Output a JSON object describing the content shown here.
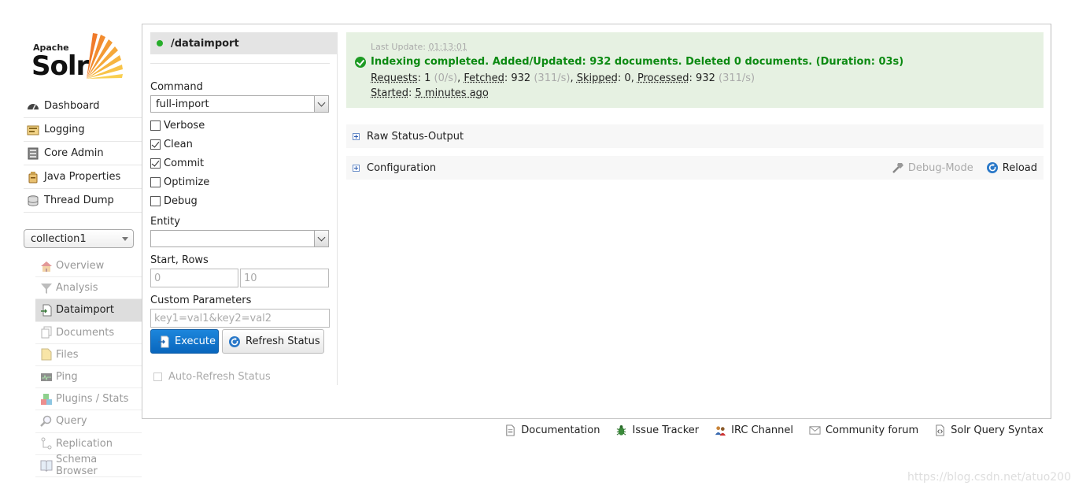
{
  "logo": {
    "apache": "Apache",
    "solr": "Solr"
  },
  "main_nav": [
    {
      "label": "Dashboard",
      "icon": "dashboard-icon"
    },
    {
      "label": "Logging",
      "icon": "logging-icon"
    },
    {
      "label": "Core Admin",
      "icon": "core-admin-icon"
    },
    {
      "label": "Java Properties",
      "icon": "java-properties-icon"
    },
    {
      "label": "Thread Dump",
      "icon": "thread-dump-icon"
    }
  ],
  "core_selector": {
    "value": "collection1"
  },
  "core_nav": [
    {
      "label": "Overview",
      "icon": "overview-icon"
    },
    {
      "label": "Analysis",
      "icon": "analysis-icon"
    },
    {
      "label": "Dataimport",
      "icon": "dataimport-icon",
      "active": true
    },
    {
      "label": "Documents",
      "icon": "documents-icon"
    },
    {
      "label": "Files",
      "icon": "files-icon"
    },
    {
      "label": "Ping",
      "icon": "ping-icon"
    },
    {
      "label": "Plugins / Stats",
      "icon": "plugins-icon"
    },
    {
      "label": "Query",
      "icon": "query-icon"
    },
    {
      "label": "Replication",
      "icon": "replication-icon"
    },
    {
      "label": "Schema Browser",
      "icon": "schema-browser-icon"
    }
  ],
  "form": {
    "handler": "/dataimport",
    "command_label": "Command",
    "command_value": "full-import",
    "checkboxes": [
      {
        "label": "Verbose",
        "checked": false
      },
      {
        "label": "Clean",
        "checked": true
      },
      {
        "label": "Commit",
        "checked": true
      },
      {
        "label": "Optimize",
        "checked": false
      },
      {
        "label": "Debug",
        "checked": false
      }
    ],
    "entity_label": "Entity",
    "entity_value": "",
    "start_rows_label": "Start, Rows",
    "start_placeholder": "0",
    "rows_placeholder": "10",
    "custom_label": "Custom Parameters",
    "custom_placeholder": "key1=val1&key2=val2",
    "execute_label": "Execute",
    "refresh_label": "Refresh Status",
    "auto_refresh_label": "Auto-Refresh Status"
  },
  "status": {
    "last_update_label": "Last Update:",
    "last_update_value": "01:13:01",
    "message": "Indexing completed. Added/Updated: 932 documents. Deleted 0 documents. (Duration: 03s)",
    "requests_label": "Requests",
    "requests_value": "1",
    "requests_rate": "(0/s)",
    "fetched_label": "Fetched",
    "fetched_value": "932",
    "fetched_rate": "(311/s)",
    "skipped_label": "Skipped",
    "skipped_value": "0",
    "processed_label": "Processed",
    "processed_value": "932",
    "processed_rate": "(311/s)",
    "started_label": "Started",
    "started_value": "5 minutes ago"
  },
  "raw_status_label": "Raw Status-Output",
  "configuration_label": "Configuration",
  "debug_mode_label": "Debug-Mode",
  "reload_label": "Reload",
  "footer": [
    {
      "label": "Documentation",
      "icon": "documentation-icon"
    },
    {
      "label": "Issue Tracker",
      "icon": "bug-icon"
    },
    {
      "label": "IRC Channel",
      "icon": "irc-icon"
    },
    {
      "label": "Community forum",
      "icon": "mail-icon"
    },
    {
      "label": "Solr Query Syntax",
      "icon": "query-syntax-icon"
    }
  ],
  "watermark": "https://blog.csdn.net/atuo200",
  "colors": {
    "accent": "#0966bd",
    "success": "#0c8a12",
    "status_bg": "#e6f1e2"
  }
}
